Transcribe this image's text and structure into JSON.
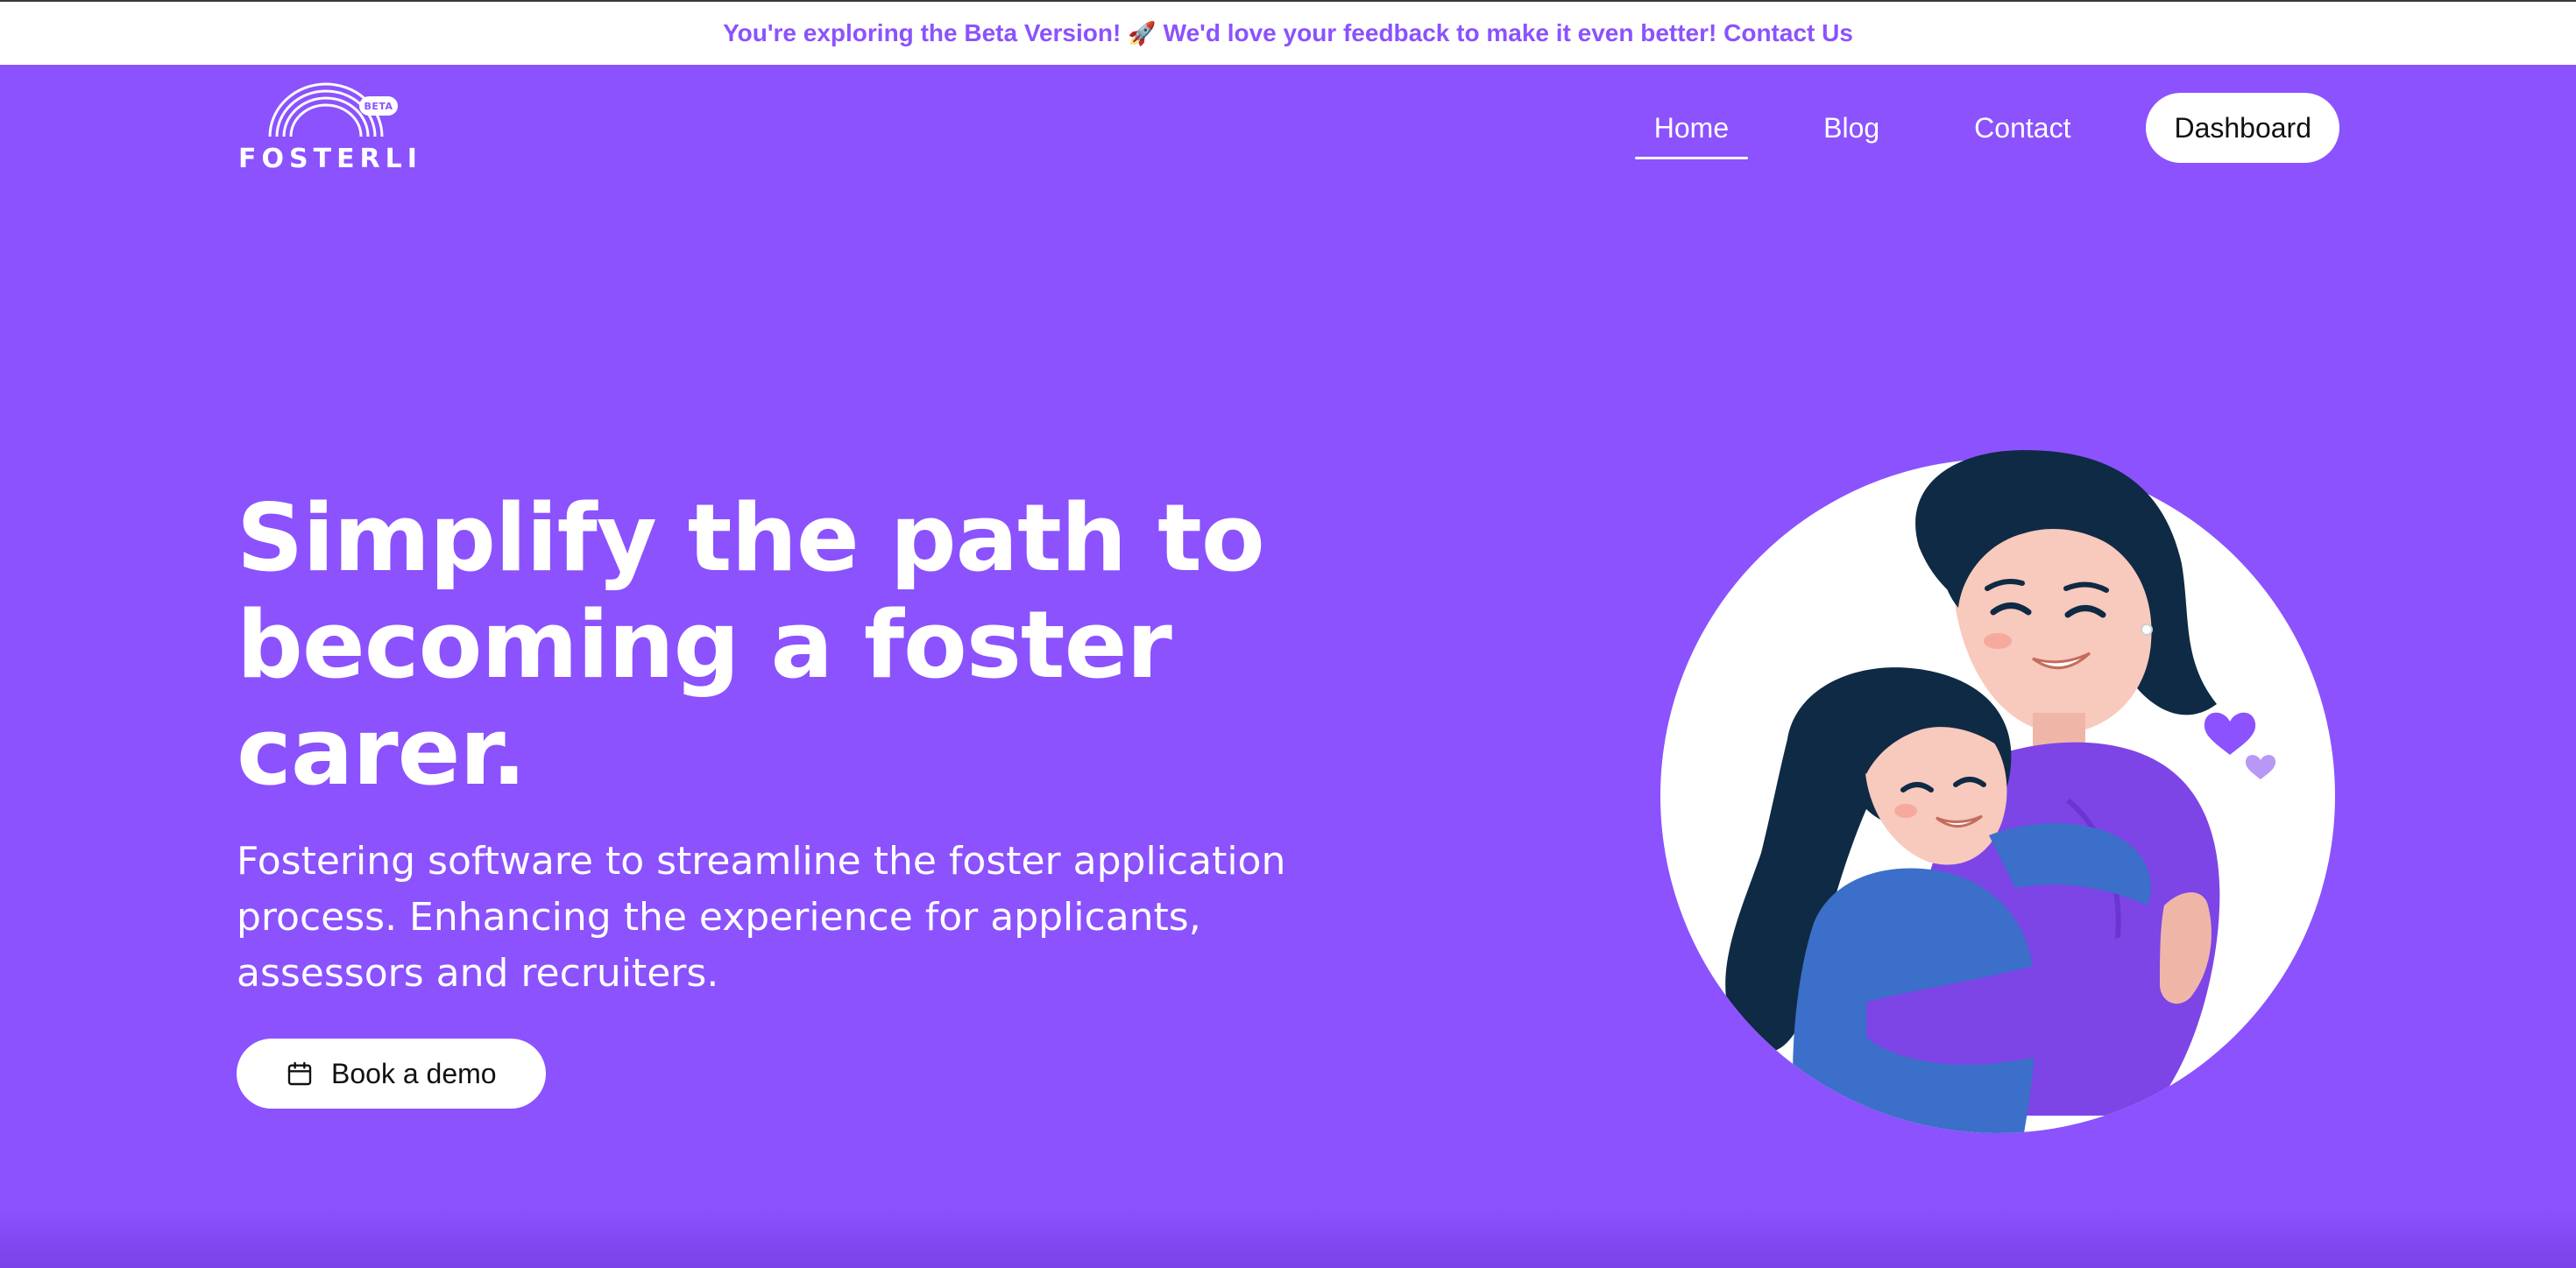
{
  "banner": {
    "text_start": "You're exploring the Beta Version!",
    "rocket": "🚀",
    "text_end": "We'd love your feedback to make it even better! Contact Us"
  },
  "logo": {
    "wordmark": "FOSTERLI",
    "badge": "BETA"
  },
  "nav": {
    "items": [
      {
        "label": "Home",
        "active": true
      },
      {
        "label": "Blog",
        "active": false
      },
      {
        "label": "Contact",
        "active": false
      }
    ],
    "cta_label": "Dashboard"
  },
  "hero": {
    "headline": "Simplify the path to becoming a foster carer.",
    "subtitle": "Fostering software to streamline the foster application process. Enhancing the experience for applicants, assessors and recruiters.",
    "demo_button_label": "Book a demo",
    "demo_icon": "calendar-icon",
    "illustration": "mother-hugging-child-illustration"
  },
  "colors": {
    "brand_purple": "#8b52fe",
    "white": "#ffffff",
    "hair_navy": "#0f2a44"
  }
}
